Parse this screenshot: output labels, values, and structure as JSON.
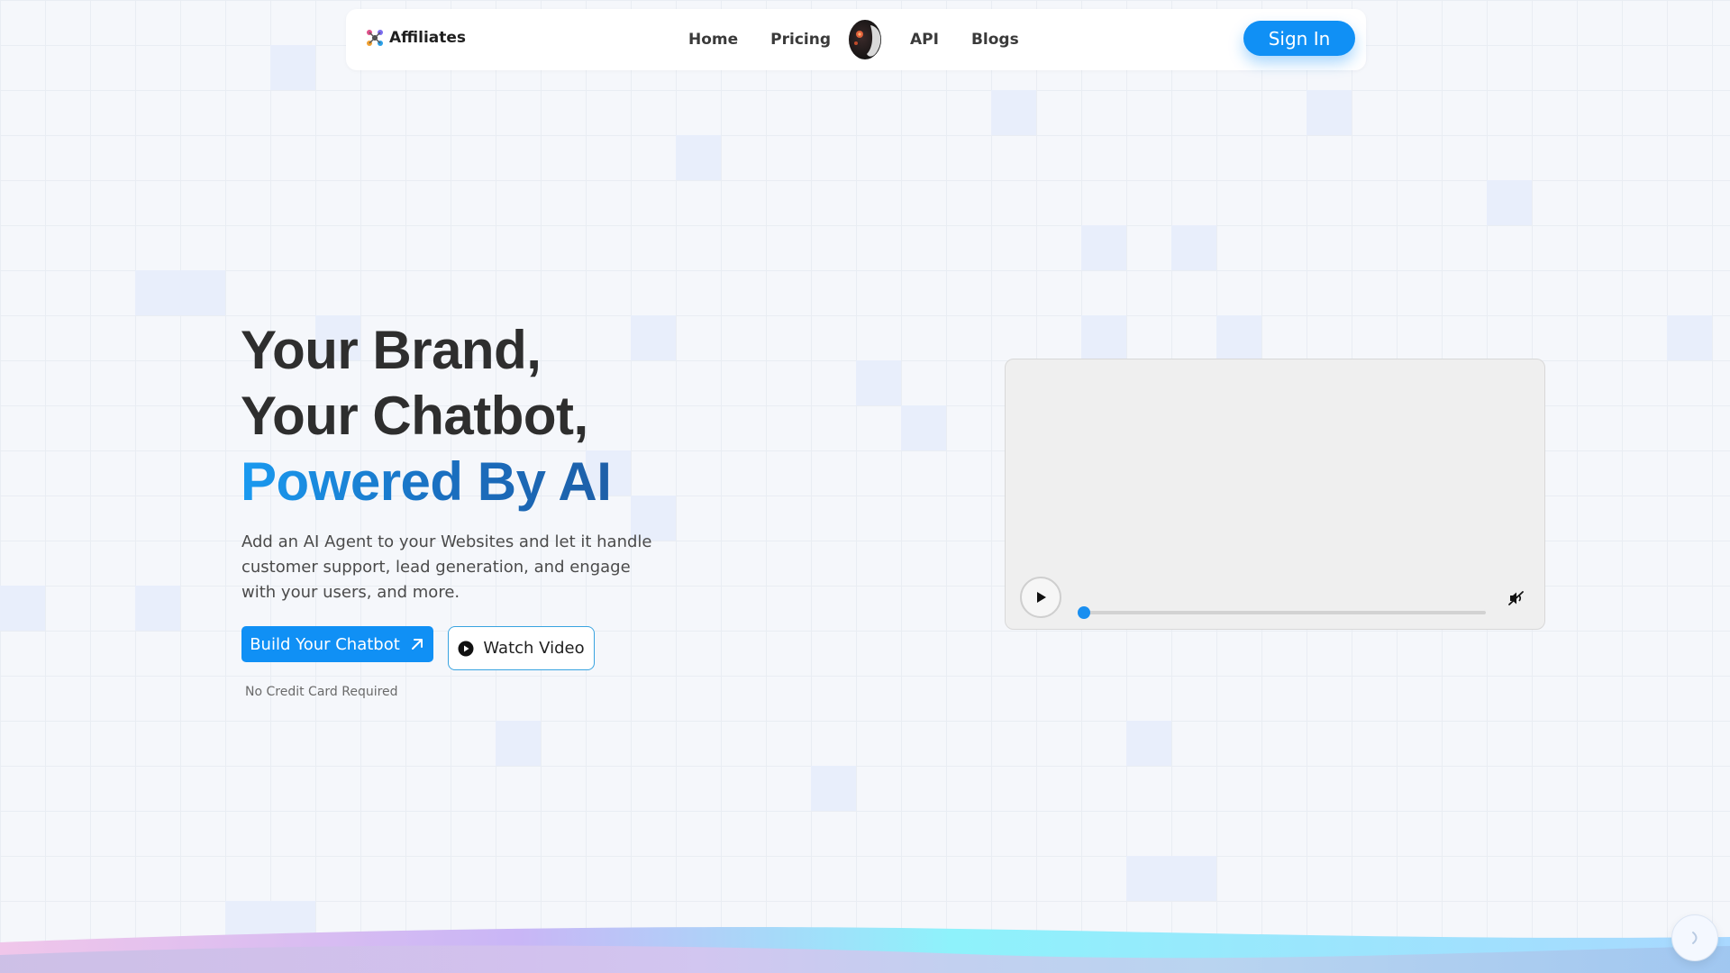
{
  "nav": {
    "brand": "Affiliates",
    "links": [
      "Home",
      "Pricing",
      "API",
      "Blogs"
    ],
    "sign_in": "Sign In"
  },
  "hero": {
    "title_line1": "Your Brand,",
    "title_line2": "Your Chatbot,",
    "title_line3": "Powered By AI",
    "description": "Add an AI Agent to your Websites and let it handle customer support, lead generation, and engage with your users, and more.",
    "primary_cta": "Build Your Chatbot",
    "secondary_cta": "Watch Video",
    "note": "No Credit Card Required"
  },
  "video": {
    "progress": 0,
    "muted": true
  },
  "colors": {
    "accent": "#1090f5",
    "title_gradient_start": "#1a9af0",
    "title_gradient_end": "#1e5fa8"
  },
  "icons": [
    "brand-logo-icon",
    "avatar",
    "arrow-up-right-icon",
    "play-circle-icon",
    "play-icon",
    "mute-icon",
    "chat-icon"
  ]
}
